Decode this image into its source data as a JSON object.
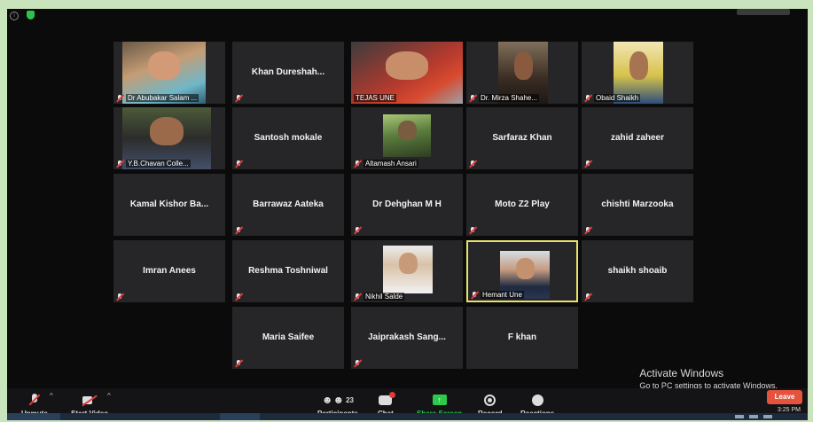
{
  "participants": [
    {
      "name": "Dr Abubakar Salam ...",
      "video": "v1",
      "muted": true,
      "face": "#d29a76"
    },
    {
      "name": "Khan  Dureshah...",
      "video": null,
      "muted": true
    },
    {
      "name": "TEJAS UNE",
      "video": "v2",
      "muted": false,
      "face": "#c88e6a"
    },
    {
      "name": "Dr. Mirza Shahe...",
      "video": "v3",
      "muted": true,
      "face": "#8a5a40"
    },
    {
      "name": "Obaid Shaikh",
      "video": "v4",
      "muted": true,
      "face": "#a77452"
    },
    {
      "name": "Y.B.Chavan Colle...",
      "video": "v5",
      "muted": true,
      "face": "#9a6a4a"
    },
    {
      "name": "Santosh mokale",
      "video": null,
      "muted": true
    },
    {
      "name": "Altamash Ansari",
      "video": "v6",
      "muted": true,
      "face": "#7a5c40"
    },
    {
      "name": "Sarfaraz Khan",
      "video": null,
      "muted": true
    },
    {
      "name": "zahid zaheer",
      "video": null,
      "muted": true
    },
    {
      "name": "Kamal Kishor Ba...",
      "video": null,
      "muted": false
    },
    {
      "name": "Barrawaz Aateka",
      "video": null,
      "muted": true
    },
    {
      "name": "Dr Dehghan  M H",
      "video": null,
      "muted": true
    },
    {
      "name": "Moto Z2 Play",
      "video": null,
      "muted": true
    },
    {
      "name": "chishti Marzooka",
      "video": null,
      "muted": true
    },
    {
      "name": "Imran Anees",
      "video": null,
      "muted": true
    },
    {
      "name": "Reshma Toshniwal",
      "video": null,
      "muted": true
    },
    {
      "name": "Nikhil Salde",
      "video": "v7",
      "muted": true,
      "face": "#c89b78"
    },
    {
      "name": "Hemant Une",
      "video": "v8",
      "muted": true,
      "active": true,
      "face": "#c4916e"
    },
    {
      "name": "shaikh shoaib",
      "video": null,
      "muted": true
    },
    {
      "name": "Maria Saifee",
      "video": null,
      "muted": true
    },
    {
      "name": "Jaiprakash  Sang...",
      "video": null,
      "muted": true
    },
    {
      "name": "F khan",
      "video": null,
      "muted": false
    }
  ],
  "toolbar": {
    "unmute": "Unmute",
    "start_video": "Start Video",
    "participants": "Participants",
    "participants_count": "23",
    "chat": "Chat",
    "share_screen": "Share Screen",
    "record": "Record",
    "reactions": "Reactions",
    "leave": "Leave"
  },
  "watermark": {
    "line1": "Activate Windows",
    "line2": "Go to PC settings to activate Windows."
  },
  "clock": "3:25 PM",
  "colors": {
    "active_border": "#e8e16a",
    "share_green": "#2ec84d",
    "leave_red": "#e5533d",
    "muted_red": "#e23b3b"
  }
}
